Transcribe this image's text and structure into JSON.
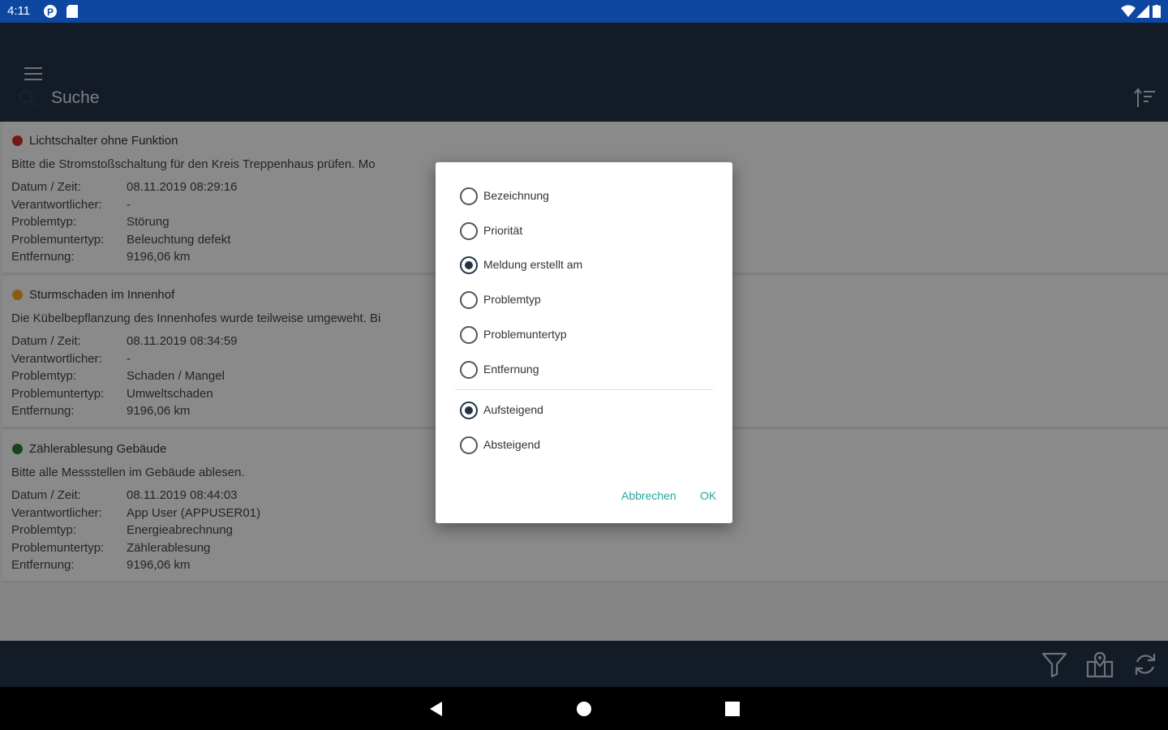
{
  "status_bar": {
    "time": "4:11"
  },
  "search": {
    "placeholder": "Suche"
  },
  "tickets": [
    {
      "title": "Lichtschalter ohne Funktion",
      "priority_color": "#d32f2f",
      "description": "Bitte die Stromstoßschaltung für den Kreis Treppenhaus prüfen. Mo",
      "fields": [
        {
          "label": "Datum / Zeit:",
          "value": "08.11.2019 08:29:16"
        },
        {
          "label": "Verantwortlicher:",
          "value": "-"
        },
        {
          "label": "Problemtyp:",
          "value": "Störung"
        },
        {
          "label": "Problemuntertyp:",
          "value": "Beleuchtung defekt"
        },
        {
          "label": "Entfernung:",
          "value": "9196,06 km"
        }
      ]
    },
    {
      "title": "Sturmschaden im Innenhof",
      "priority_color": "#f9a825",
      "description": "Die Kübelbepflanzung des Innenhofes wurde teilweise umgeweht. Bi",
      "fields": [
        {
          "label": "Datum / Zeit:",
          "value": "08.11.2019 08:34:59"
        },
        {
          "label": "Verantwortlicher:",
          "value": "-"
        },
        {
          "label": "Problemtyp:",
          "value": "Schaden / Mangel"
        },
        {
          "label": "Problemuntertyp:",
          "value": "Umweltschaden"
        },
        {
          "label": "Entfernung:",
          "value": "9196,06 km"
        }
      ]
    },
    {
      "title": "Zählerablesung Gebäude",
      "priority_color": "#2e7d32",
      "description": "Bitte alle Messstellen im Gebäude ablesen.",
      "fields": [
        {
          "label": "Datum / Zeit:",
          "value": "08.11.2019 08:44:03"
        },
        {
          "label": "Verantwortlicher:",
          "value": "App User (APPUSER01)"
        },
        {
          "label": "Problemtyp:",
          "value": "Energieabrechnung"
        },
        {
          "label": "Problemuntertyp:",
          "value": "Zählerablesung"
        },
        {
          "label": "Entfernung:",
          "value": "9196,06 km"
        }
      ]
    }
  ],
  "sort_dialog": {
    "sort_fields": [
      {
        "label": "Bezeichnung",
        "checked": false
      },
      {
        "label": "Priorität",
        "checked": false
      },
      {
        "label": "Meldung erstellt am",
        "checked": true
      },
      {
        "label": "Problemtyp",
        "checked": false
      },
      {
        "label": "Problemuntertyp",
        "checked": false
      },
      {
        "label": "Entfernung",
        "checked": false
      }
    ],
    "sort_order": [
      {
        "label": "Aufsteigend",
        "checked": true
      },
      {
        "label": "Absteigend",
        "checked": false
      }
    ],
    "cancel_label": "Abbrechen",
    "ok_label": "OK"
  },
  "icons": {
    "menu": "hamburger-icon",
    "search": "search-icon",
    "sort": "sort-icon",
    "filter": "filter-icon",
    "map": "map-icon",
    "refresh": "refresh-icon"
  }
}
